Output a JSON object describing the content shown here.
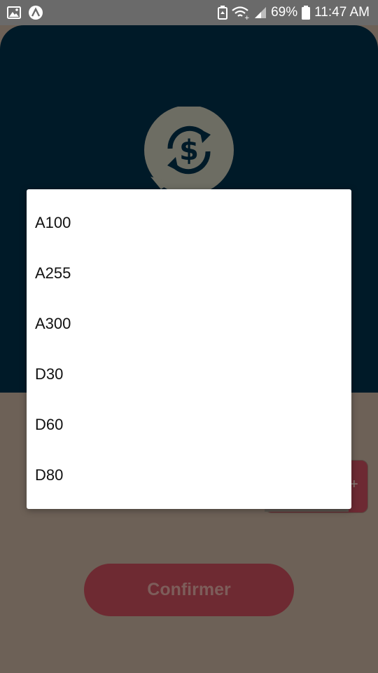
{
  "status_bar": {
    "battery": "69%",
    "time": "11:47 AM",
    "icons": [
      "image-icon",
      "app-a-icon",
      "battery-saver-icon",
      "wifi-icon",
      "signal-icon",
      "battery-icon"
    ]
  },
  "colors": {
    "overlay_bg": "#6d6157",
    "header_bg": "#001a28",
    "button_bg": "#6e2a32",
    "dialog_bg": "#ffffff"
  },
  "dropdown": {
    "options": [
      "A100",
      "A255",
      "A300",
      "D30",
      "D60",
      "D80"
    ]
  },
  "confirm": {
    "label": "Confirmer"
  },
  "logo": {
    "icon": "currency-exchange-icon"
  }
}
